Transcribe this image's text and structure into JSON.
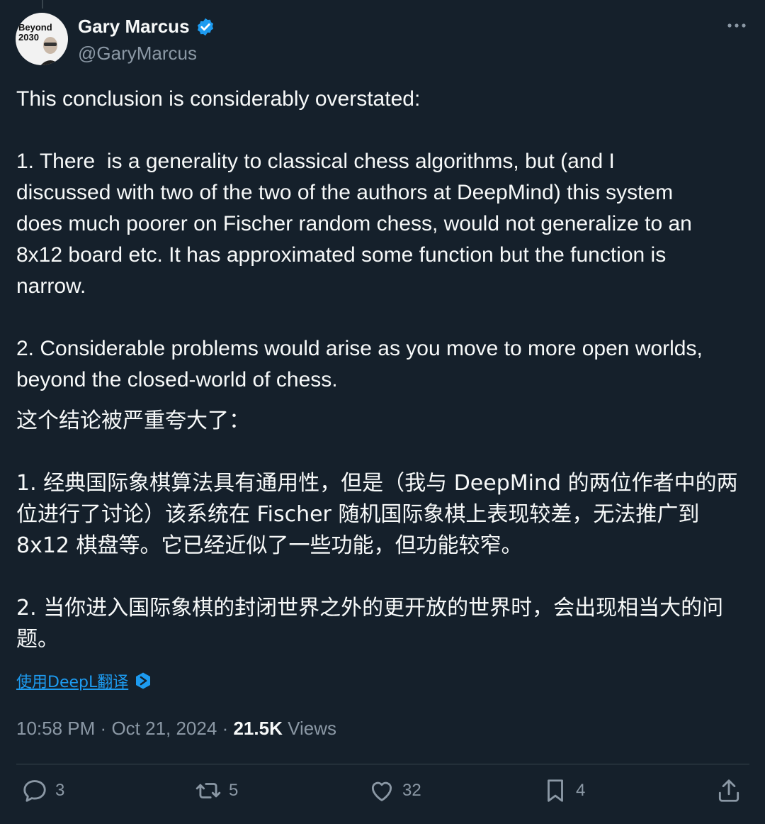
{
  "author": {
    "display_name": "Gary Marcus",
    "handle": "@GaryMarcus",
    "avatar_text_line1": "Beyond",
    "avatar_text_line2": "2030"
  },
  "post": {
    "text_en": "This conclusion is considerably overstated:\n\n1. There  is a generality to classical chess algorithms, but (and I\ndiscussed with two of the two of the authors at DeepMind) this system\ndoes much poorer on Fischer random chess, would not generalize to an\n8x12 board etc. It has approximated some function but the function is\nnarrow.\n\n2. Considerable problems would arise as you move to more open worlds,\nbeyond the closed-world of chess.",
    "text_zh": "这个结论被严重夸大了：\n\n1. 经典国际象棋算法具有通用性，但是（我与 DeepMind 的两位作者中的两\n位进行了讨论）该系统在 Fischer 随机国际象棋上表现较差，无法推广到\n8x12 棋盘等。它已经近似了一些功能，但功能较窄。\n\n2. 当你进入国际象棋的封闭世界之外的更开放的世界时，会出现相当大的问\n题。",
    "translate_label": "使用DeepL翻译"
  },
  "meta": {
    "time": "10:58 PM",
    "separator": "·",
    "date": "Oct 21, 2024",
    "views_count": "21.5K",
    "views_label": "Views"
  },
  "actions": {
    "replies": "3",
    "reposts": "5",
    "likes": "32",
    "bookmarks": "4"
  },
  "colors": {
    "background": "#15202b",
    "text": "#f7f9f9",
    "secondary": "#8b98a5",
    "accent": "#1d9bf0"
  }
}
